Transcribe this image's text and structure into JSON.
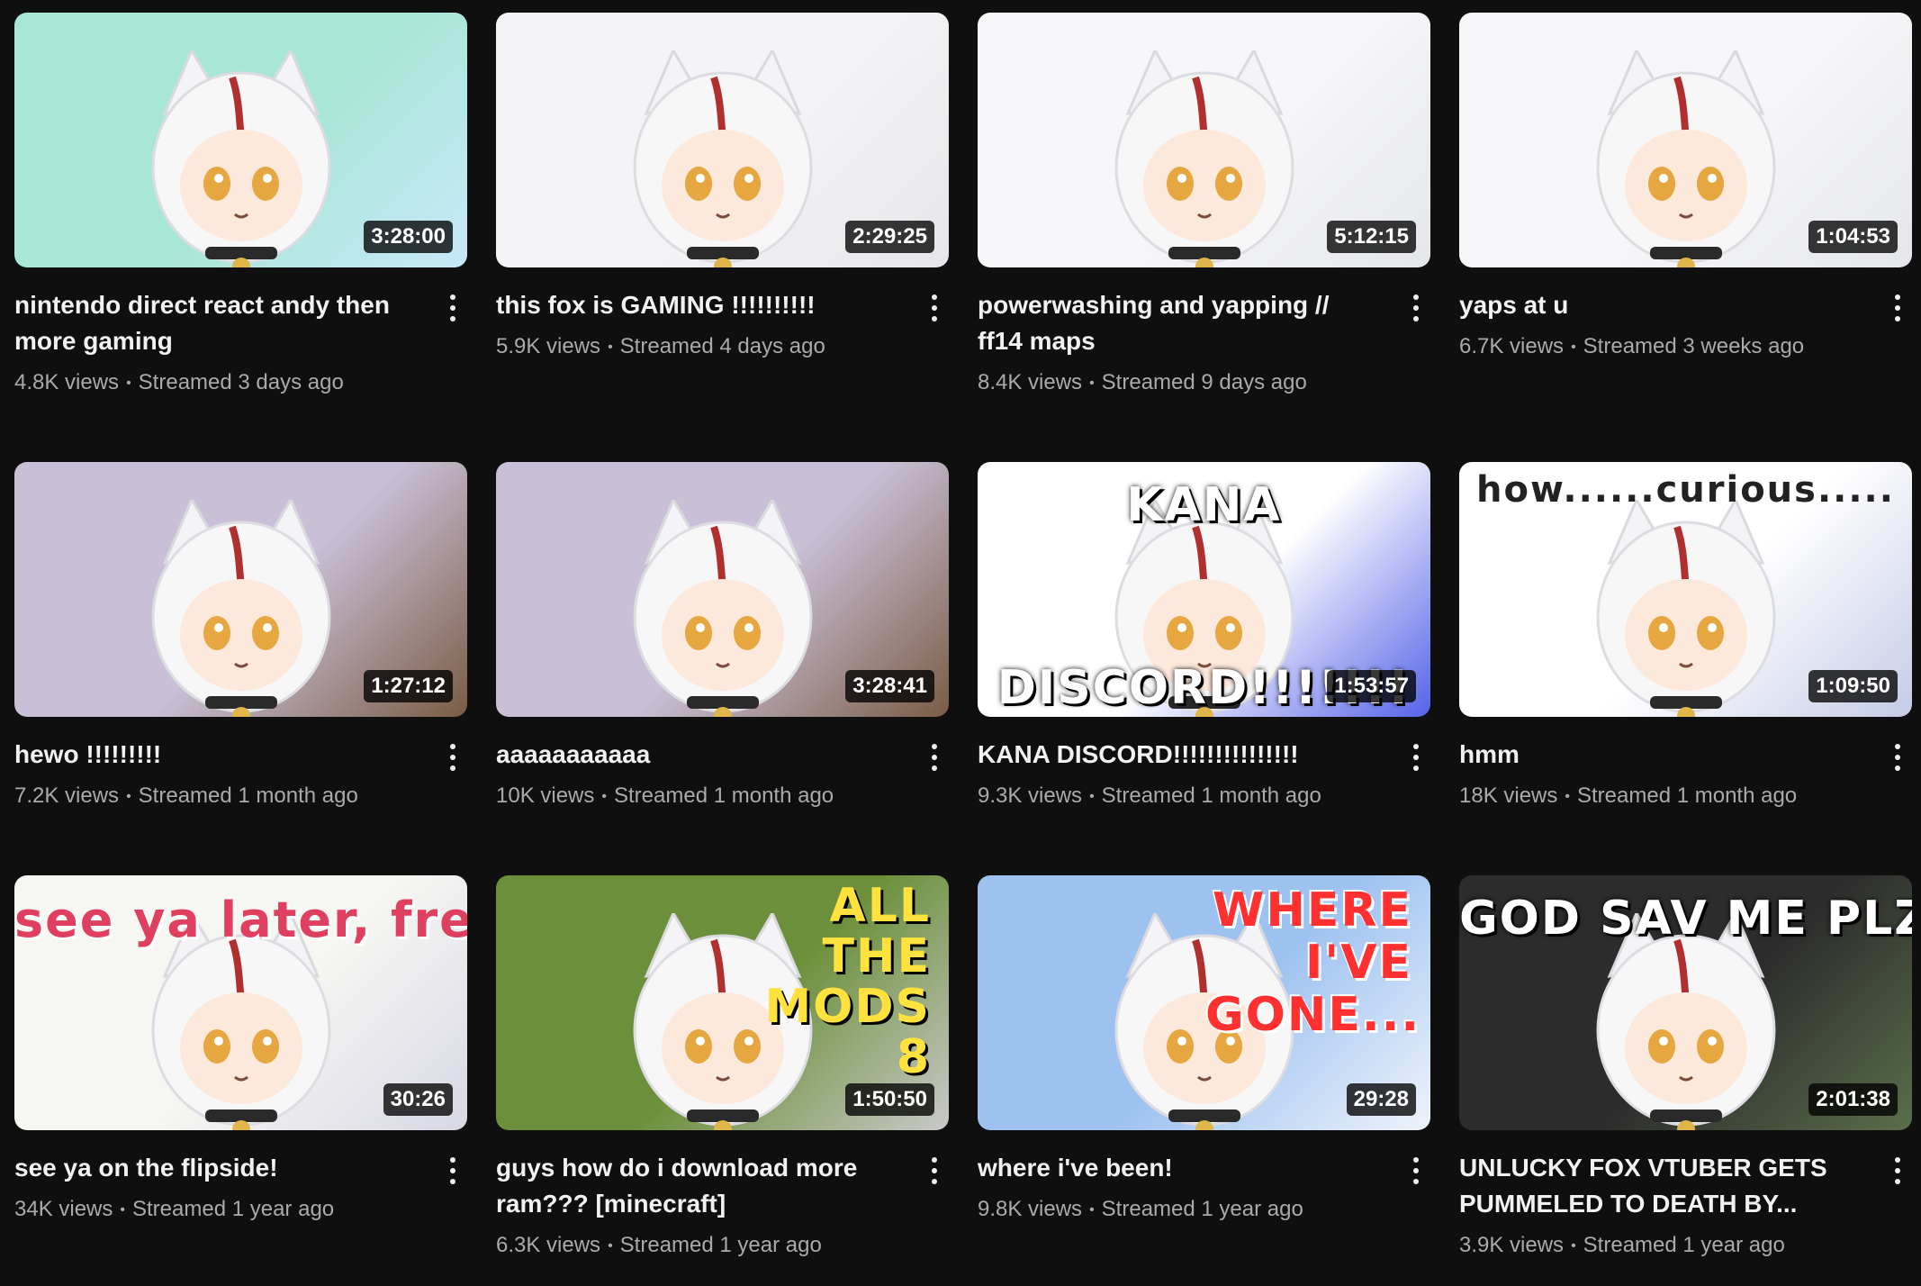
{
  "videos": [
    {
      "title": "nintendo direct react andy then more gaming",
      "views": "4.8K views",
      "age": "Streamed 3 days ago",
      "duration": "3:28:00",
      "caption": "",
      "bg": "#a8e6d6",
      "accent": "#c8e8f8"
    },
    {
      "title": "this fox is GAMING !!!!!!!!!!",
      "views": "5.9K views",
      "age": "Streamed 4 days ago",
      "duration": "2:29:25",
      "caption": "",
      "bg": "#f4f4f6",
      "accent": "#e6e6ea"
    },
    {
      "title": "powerwashing and yapping // ff14 maps",
      "views": "8.4K views",
      "age": "Streamed 9 days ago",
      "duration": "5:12:15",
      "caption": "",
      "bg": "#f7f7f9",
      "accent": "#e4e6ea"
    },
    {
      "title": "yaps at u",
      "views": "6.7K views",
      "age": "Streamed 3 weeks ago",
      "duration": "1:04:53",
      "caption": "",
      "bg": "#f7f7f9",
      "accent": "#e4e6ea"
    },
    {
      "title": "hewo !!!!!!!!!",
      "views": "7.2K views",
      "age": "Streamed 1 month ago",
      "duration": "1:27:12",
      "caption": "",
      "bg": "#c9bfd6",
      "accent": "#7a5c44"
    },
    {
      "title": "aaaaaaaaaaa",
      "views": "10K views",
      "age": "Streamed 1 month ago",
      "duration": "3:28:41",
      "caption": "",
      "bg": "#c9bfd6",
      "accent": "#7a5c44"
    },
    {
      "title": "KANA DISCORD!!!!!!!!!!!!!!!",
      "views": "9.3K views",
      "age": "Streamed 1 month ago",
      "duration": "1:53:57",
      "caption": "KANA",
      "caption2": "DISCORD!!!!!!!",
      "bg": "#ffffff",
      "accent": "#5563e8"
    },
    {
      "title": "hmm",
      "views": "18K views",
      "age": "Streamed 1 month ago",
      "duration": "1:09:50",
      "caption": "how......curious.....",
      "bg": "#ffffff",
      "accent": "#c4cbe6"
    },
    {
      "title": "see ya on the flipside!",
      "views": "34K views",
      "age": "Streamed 1 year ago",
      "duration": "30:26",
      "caption": "see ya later, frens!",
      "bg": "#f6f6f2",
      "accent": "#d8d8e6"
    },
    {
      "title": "guys how do i download more ram??? [minecraft]",
      "views": "6.3K views",
      "age": "Streamed 1 year ago",
      "duration": "1:50:50",
      "caption": "ALL THE MODS 8",
      "bg": "#6b8f3a",
      "accent": "#c9c9c9"
    },
    {
      "title": "where i've been!",
      "views": "9.8K views",
      "age": "Streamed 1 year ago",
      "duration": "29:28",
      "caption": "WHERE I'VE GONE...",
      "bg": "#9ec2f0",
      "accent": "#eef3fb"
    },
    {
      "title": "UNLUCKY FOX VTUBER GETS PUMMELED TO DEATH BY...",
      "views": "3.9K views",
      "age": "Streamed 1 year ago",
      "duration": "2:01:38",
      "caption": "GOD SAV ME PLZ",
      "bg": "#2c2c2c",
      "accent": "#5a6e4a"
    }
  ]
}
